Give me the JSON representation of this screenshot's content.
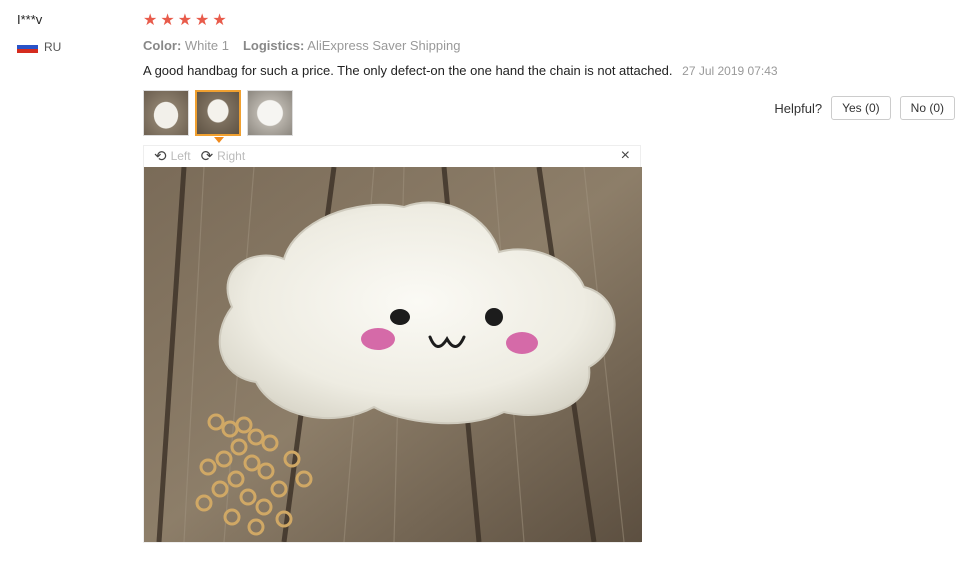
{
  "reviewer": {
    "name": "I***v",
    "country": "RU"
  },
  "rating": {
    "stars": 5
  },
  "meta": {
    "color_label": "Color:",
    "color_value": "White 1",
    "logistics_label": "Logistics:",
    "logistics_value": "AliExpress Saver Shipping"
  },
  "review": {
    "text": "A good handbag for such a price. The only defect-on the one hand the chain is not attached.",
    "date": "27 Jul 2019 07:43"
  },
  "helpful": {
    "label": "Helpful?",
    "yes": "Yes (0)",
    "no": "No (0)"
  },
  "viewer": {
    "left_label": "Left",
    "right_label": "Right",
    "close": "×"
  },
  "colors": {
    "star": "#e85b4b",
    "thumb_active": "#f0a030"
  }
}
